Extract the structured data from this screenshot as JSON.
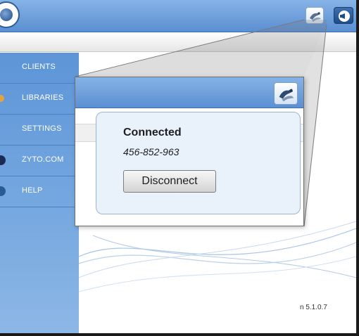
{
  "sidebar": {
    "items": [
      {
        "label": "CLIENTS"
      },
      {
        "label": "LIBRARIES"
      },
      {
        "label": "SETTINGS"
      },
      {
        "label": "ZYTO.COM"
      },
      {
        "label": "HELP"
      }
    ]
  },
  "popup": {
    "status": "Connected",
    "session_id": "456-852-963",
    "disconnect_label": "Disconnect"
  },
  "footer": {
    "version": "n 5.1.0.7"
  },
  "toolbar": {
    "icons": [
      "remote-support-icon",
      "notification-icon"
    ]
  },
  "colors": {
    "header_blue": "#5b8fd2",
    "sidebar_blue": "#6a9fdc",
    "popup_bg": "#e9f1fb"
  }
}
